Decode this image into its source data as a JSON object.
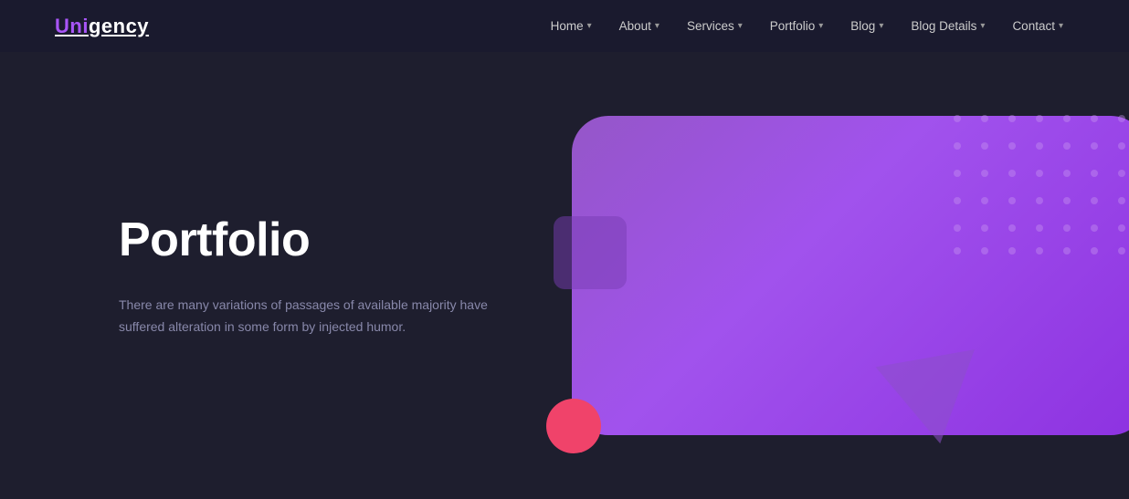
{
  "logo": {
    "uni": "Uni",
    "gency": "gency"
  },
  "nav": {
    "items": [
      {
        "label": "Home",
        "hasDropdown": true
      },
      {
        "label": "About",
        "hasDropdown": true
      },
      {
        "label": "Services",
        "hasDropdown": true
      },
      {
        "label": "Portfolio",
        "hasDropdown": true
      },
      {
        "label": "Blog",
        "hasDropdown": true
      },
      {
        "label": "Blog Details",
        "hasDropdown": true
      },
      {
        "label": "Contact",
        "hasDropdown": true
      }
    ]
  },
  "hero": {
    "title": "Portfolio",
    "description": "There are many variations of passages of available majority have suffered alteration in some form by injected humor."
  },
  "colors": {
    "accent_purple": "#a855f7",
    "logo_purple": "#a855f7",
    "bg_dark": "#1e1e2e",
    "pink": "#f0436a"
  }
}
